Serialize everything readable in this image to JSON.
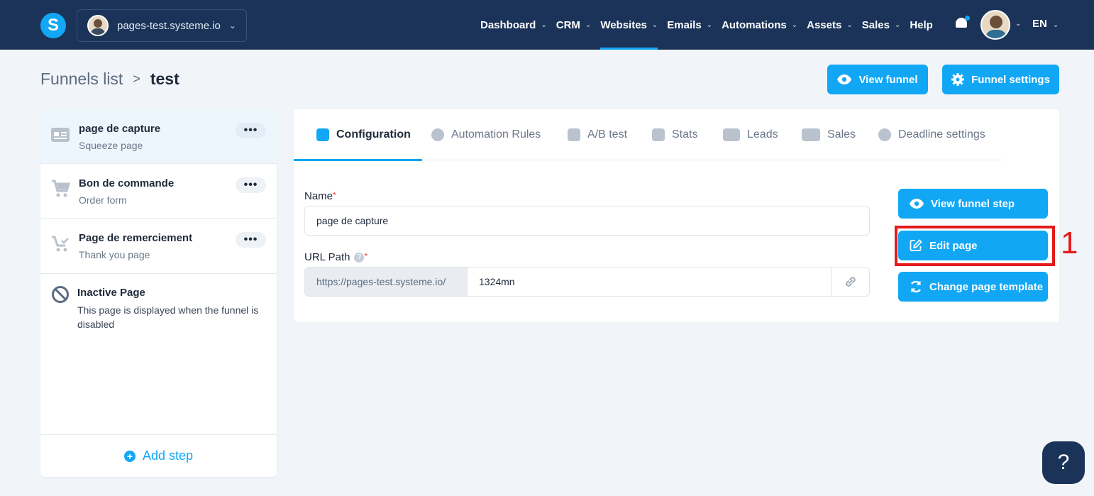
{
  "topbar": {
    "logo": "S",
    "site_name": "pages-test.systeme.io",
    "nav": [
      {
        "label": "Dashboard",
        "caret": true,
        "active": false
      },
      {
        "label": "CRM",
        "caret": true,
        "active": false
      },
      {
        "label": "Websites",
        "caret": true,
        "active": true
      },
      {
        "label": "Emails",
        "caret": true,
        "active": false
      },
      {
        "label": "Automations",
        "caret": true,
        "active": false
      },
      {
        "label": "Assets",
        "caret": true,
        "active": false
      },
      {
        "label": "Sales",
        "caret": true,
        "active": false
      },
      {
        "label": "Help",
        "caret": false,
        "active": false
      }
    ],
    "language": "EN"
  },
  "breadcrumb": {
    "parent": "Funnels list",
    "current": "test"
  },
  "header_buttons": {
    "view_funnel": "View funnel",
    "funnel_settings": "Funnel settings"
  },
  "steps": [
    {
      "title": "page de capture",
      "subtitle": "Squeeze page",
      "active": true,
      "icon": "squeeze-page-icon"
    },
    {
      "title": "Bon de commande",
      "subtitle": "Order form",
      "active": false,
      "icon": "cart-icon"
    },
    {
      "title": "Page de remerciement",
      "subtitle": "Thank you page",
      "active": false,
      "icon": "cart-check-icon"
    }
  ],
  "inactive_page": {
    "title": "Inactive Page",
    "description": "This page is displayed when the funnel is disabled"
  },
  "add_step": "Add step",
  "tabs": [
    {
      "label": "Configuration",
      "icon": "sliders-icon",
      "active": true
    },
    {
      "label": "Automation Rules",
      "icon": "bolt-icon",
      "active": false
    },
    {
      "label": "A/B test",
      "icon": "split-icon",
      "active": false
    },
    {
      "label": "Stats",
      "icon": "bar-chart-icon",
      "active": false
    },
    {
      "label": "Leads",
      "icon": "users-icon",
      "active": false
    },
    {
      "label": "Sales",
      "icon": "dollar-icon",
      "active": false
    },
    {
      "label": "Deadline settings",
      "icon": "clock-icon",
      "active": false
    }
  ],
  "form": {
    "name_label": "Name",
    "name_value": "page de capture",
    "url_label": "URL Path",
    "url_prefix": "https://pages-test.systeme.io/",
    "url_path": "1324mn",
    "required_mark": "*",
    "help_mark": "?"
  },
  "actions": {
    "view_step": "View funnel step",
    "edit_page": "Edit page",
    "change_template": "Change page template"
  },
  "annotation": {
    "marker": "1",
    "color": "#e31b1b"
  },
  "help_fab": "?",
  "colors": {
    "navbar": "#1b3358",
    "accent": "#11a7f5",
    "background": "#f1f4f8"
  }
}
